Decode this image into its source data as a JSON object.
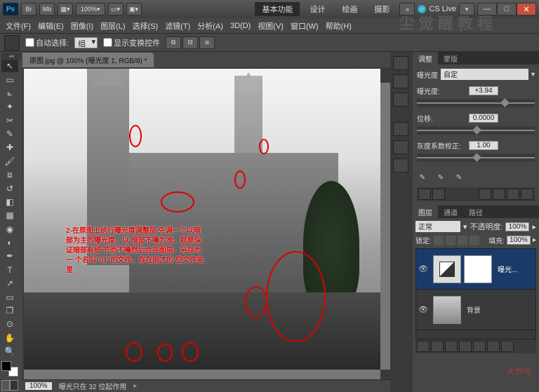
{
  "titlebar": {
    "app": "Ps",
    "btn_br": "Br",
    "btn_mb": "Mb",
    "zoom": "100%",
    "workspaces": [
      "基本功能",
      "设计",
      "绘画",
      "摄影"
    ],
    "cslive": "CS Live"
  },
  "menu": [
    "文件(F)",
    "编辑(E)",
    "图像(I)",
    "图层(L)",
    "选择(S)",
    "滤镜(T)",
    "分析(A)",
    "3D(D)",
    "视图(V)",
    "窗口(W)",
    "帮助(H)"
  ],
  "options": {
    "auto_select": "自动选择:",
    "group": "组",
    "show_transform": "显示变换控件"
  },
  "doc": {
    "tab": "原图.jpg @ 100% (曝光度 1, RGB/8) *",
    "zoom_status": "100%",
    "status_msg": "曝光只在 32 位起作用"
  },
  "canvas_text": "2-在原图上执行曝光度调整层\n先调一个以暗部为主的曝光度，以\n暗部不嗓为准，就是保证暗部有细\n节而不嗓然后合并图层，另存为一\n个名叫\"01\"的文件，存在刚才的\n空文件夹里",
  "adjust_panel": {
    "tabs": [
      "调整",
      "蒙版"
    ],
    "title": "曝光度",
    "preset": "自定",
    "exposure_label": "曝光度:",
    "exposure_value": "+3.94",
    "offset_label": "位移:",
    "offset_value": "0.0000",
    "gamma_label": "灰度系数校正:",
    "gamma_value": "1.00"
  },
  "layers_panel": {
    "tabs": [
      "图层",
      "通道",
      "路径"
    ],
    "mode": "正常",
    "opacity_label": "不透明度:",
    "opacity_value": "100%",
    "lock_label": "锁定:",
    "fill_label": "填充:",
    "fill_value": "100%",
    "layers": [
      {
        "name": "曝光..."
      },
      {
        "name": "背景"
      }
    ]
  },
  "watermark": "尘觉醒教程",
  "corner_logo": "火烈鸟"
}
